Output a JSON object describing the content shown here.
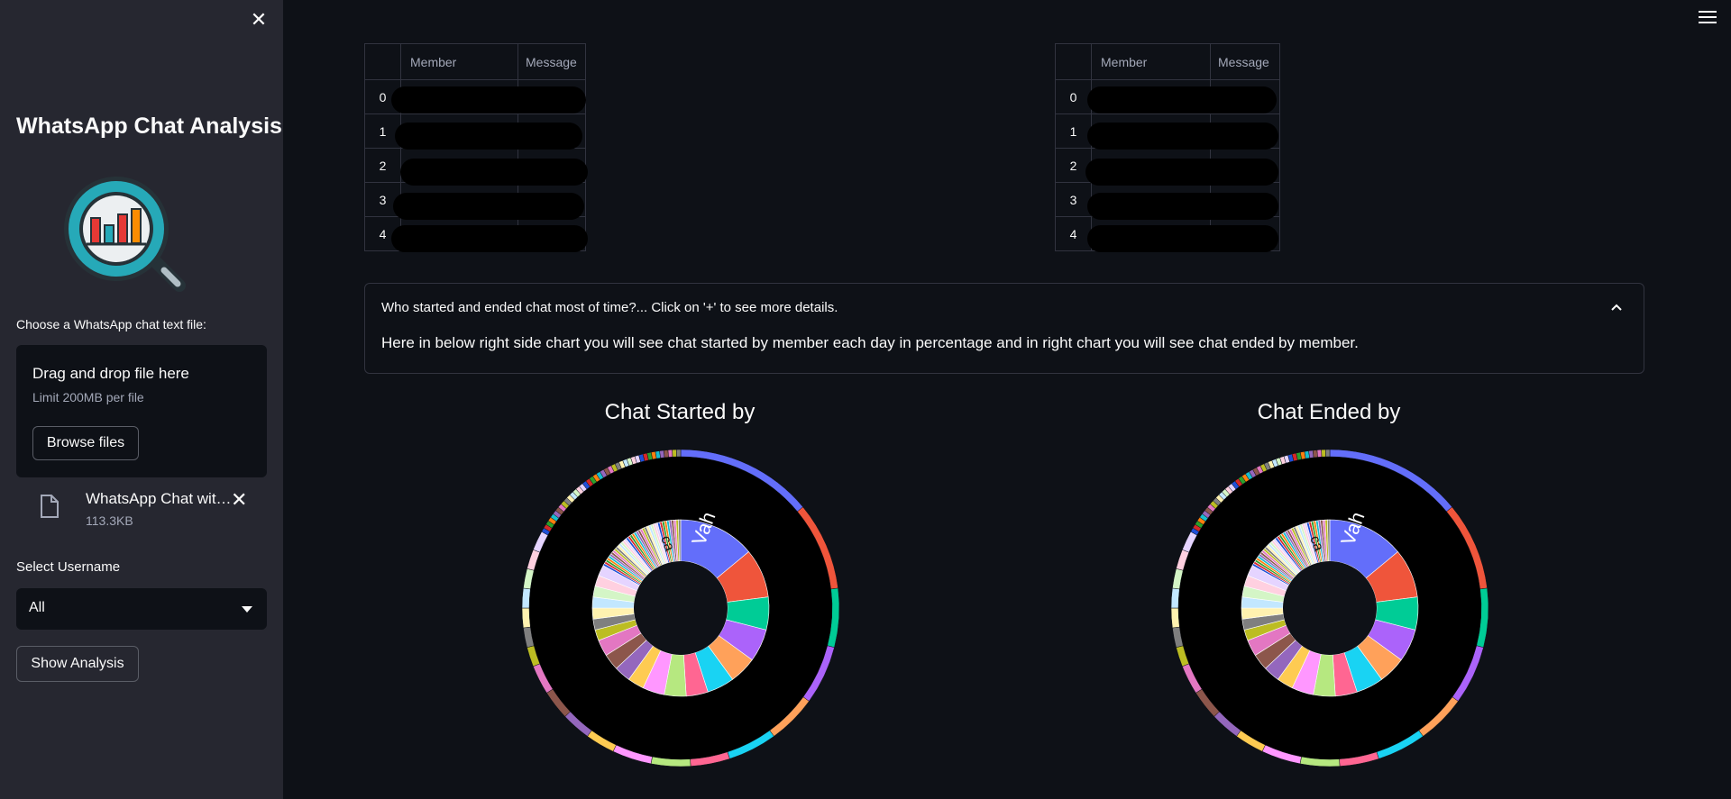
{
  "sidebar": {
    "title": "WhatsApp Chat Analysis",
    "upload_label": "Choose a WhatsApp chat text file:",
    "dropzone_title": "Drag and drop file here",
    "dropzone_limit": "Limit 200MB per file",
    "browse_label": "Browse files",
    "file_name": "WhatsApp Chat wit…",
    "file_size": "113.3KB",
    "select_label": "Select Username",
    "select_value": "All",
    "show_button": "Show Analysis"
  },
  "table_left": {
    "headers": [
      "Member",
      "Message"
    ],
    "index": [
      "0",
      "1",
      "2",
      "3",
      "4"
    ]
  },
  "table_right": {
    "headers": [
      "Member",
      "Message"
    ],
    "index": [
      "0",
      "1",
      "2",
      "3",
      "4"
    ]
  },
  "expander": {
    "header": "Who started and ended chat most of time?... Click on '+' to see more details.",
    "body": "Here in below right side chart you will see chat started by member each day in percentage and in right chart you will see chat ended by member."
  },
  "charts": {
    "left_title": "Chat Started by",
    "right_title": "Chat Ended by",
    "center_label": "Vah",
    "second_label": "ca"
  },
  "colors": {
    "background": "#0e1117",
    "sidebar": "#262730",
    "series": [
      "#636efa",
      "#ef553b",
      "#00cc96",
      "#ab63fa",
      "#ffa15a",
      "#19d3f3",
      "#ff6692",
      "#b6e880",
      "#ff97ff",
      "#fecb52"
    ]
  }
}
